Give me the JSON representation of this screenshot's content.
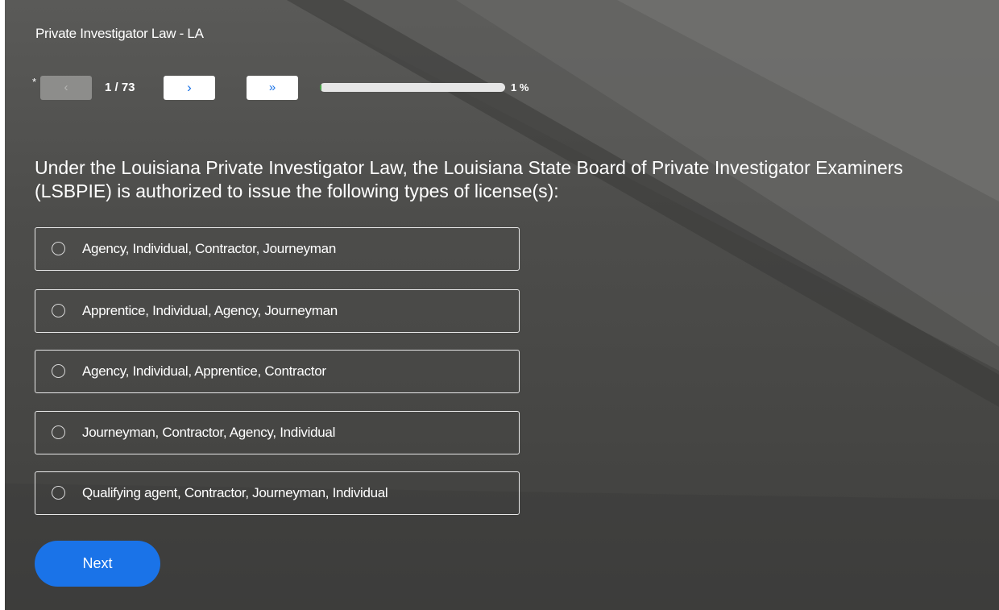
{
  "header": {
    "title": "Private Investigator Law - LA"
  },
  "nav": {
    "required_marker": "*",
    "prev_icon": "‹",
    "counter": "1 / 73",
    "next_icon": "›",
    "last_icon": "»",
    "progress_percent": 1,
    "progress_label": "1 %"
  },
  "question": {
    "text": "Under the Louisiana Private Investigator Law, the Louisiana State Board of Private Investigator Examiners (LSBPIE) is authorized to issue the following types of license(s):",
    "options": [
      {
        "label": "Agency, Individual, Contractor, Journeyman"
      },
      {
        "label": "Apprentice, Individual, Agency, Journeyman"
      },
      {
        "label": "Agency, Individual, Apprentice, Contractor"
      },
      {
        "label": "Journeyman, Contractor, Agency, Individual"
      },
      {
        "label": "Qualifying agent, Contractor, Journeyman, Individual"
      }
    ]
  },
  "actions": {
    "next_label": "Next"
  },
  "colors": {
    "accent": "#1a73e8",
    "progress": "#3ca03c",
    "background": "#4d4d4b"
  }
}
